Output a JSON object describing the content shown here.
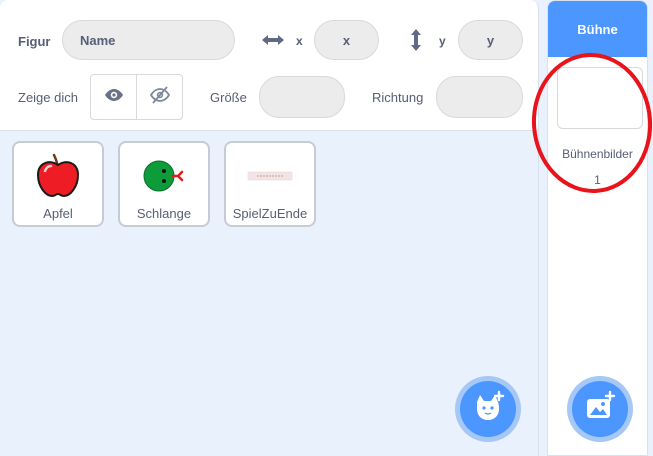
{
  "sprite_info": {
    "sprite_label": "Figur",
    "name_placeholder": "Name",
    "x_label": "x",
    "x_placeholder": "x",
    "y_label": "y",
    "y_placeholder": "y",
    "show_label": "Zeige dich",
    "size_label": "Größe",
    "direction_label": "Richtung",
    "icons": {
      "x_axis": "horizontal-arrows-icon",
      "y_axis": "vertical-arrows-icon",
      "show": "eye-icon",
      "hide": "eye-slash-icon"
    }
  },
  "sprites": [
    {
      "name": "Apfel",
      "icon": "apple-icon"
    },
    {
      "name": "Schlange",
      "icon": "snake-icon"
    },
    {
      "name": "SpielZuEnde",
      "icon": "game-over-banner-icon"
    }
  ],
  "add_sprite_button": {
    "icon": "cat-plus-icon"
  },
  "stage": {
    "header": "Bühne",
    "backdrops_label": "Bühnenbilder",
    "backdrop_count": "1",
    "add_backdrop_button": {
      "icon": "image-plus-icon"
    }
  },
  "colors": {
    "accent": "#4c97ff",
    "annotation": "#e8131b",
    "panel_bg": "#e9f1fc",
    "text": "#575e75"
  }
}
